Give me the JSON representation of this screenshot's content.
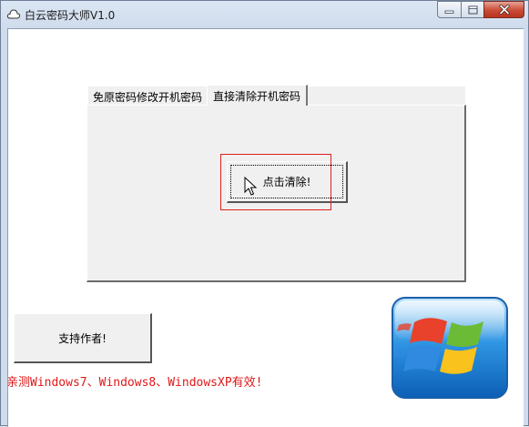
{
  "window": {
    "title": "白云密码大师V1.0",
    "icon": "cloud-icon",
    "controls": [
      "minimize-icon",
      "maximize-icon",
      "close-icon"
    ]
  },
  "tabs": [
    {
      "label": "免原密码修改开机密码",
      "active": false
    },
    {
      "label": "直接清除开机密码",
      "active": true
    }
  ],
  "main": {
    "clear_button_label": "点击清除!"
  },
  "footer": {
    "support_button_label": "支持作者!",
    "compat_note": "亲测Windows7、Windows8、WindowsXP有效!",
    "logo": "windows-logo"
  },
  "colors": {
    "note_text": "#e01818",
    "highlight_box": "#e0201c",
    "close_button": "#c94a35"
  }
}
